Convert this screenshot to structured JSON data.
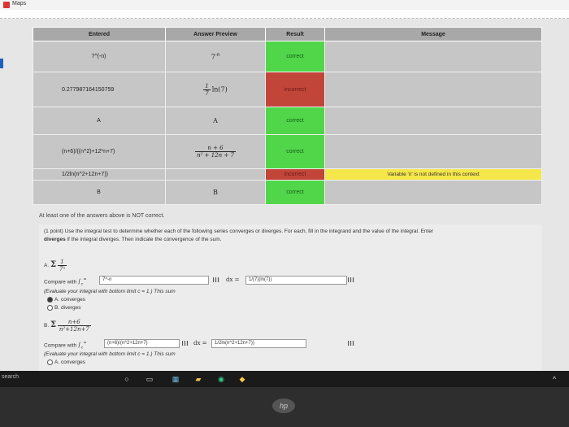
{
  "window": {
    "title": "Maps"
  },
  "table": {
    "headers": [
      "Entered",
      "Answer Preview",
      "Result",
      "Message"
    ],
    "rows": [
      {
        "entered": "7^(-n)",
        "preview_base": "7",
        "preview_exp": "-n",
        "result": "correct",
        "message": ""
      },
      {
        "entered": "0.277987164150759",
        "preview_num": "1",
        "preview_den": "7",
        "preview_rest": "ln(7)",
        "result": "incorrect",
        "message": ""
      },
      {
        "entered": "A",
        "preview": "A",
        "result": "correct",
        "message": ""
      },
      {
        "entered": "(n+6)/((n^2)+12*n+7)",
        "preview_num": "n + 6",
        "preview_den": "n² + 12n + 7",
        "result": "correct",
        "message": ""
      },
      {
        "entered": "1/2ln(n^2+12n+7))",
        "preview": "",
        "result": "incorrect",
        "message": "Variable 'n' is not defined in this context"
      },
      {
        "entered": "B",
        "preview": "B",
        "result": "correct",
        "message": ""
      }
    ]
  },
  "notice": "At least one of the answers above is NOT correct.",
  "problem": {
    "intro": "(1 point) Use the integral test to determine whether each of the following series converges or diverges. For each, fill in the integrand and the value of the integral. Enter",
    "intro2_bold": "diverges",
    "intro2": " if the integral diverges. Then indicate the convergence of the sum.",
    "partA": {
      "label": "A.",
      "term_num": "1",
      "term_den": "7ⁿ",
      "compare_label": "Compare with",
      "integrand": "7^-n",
      "dx_label": "dx =",
      "integral_value": "1/(7)(ln(7))",
      "hint": "(Evaluate your integral with bottom limit c = 1.) This sum",
      "options": [
        "A. converges",
        "B. diverges"
      ],
      "selected": 0
    },
    "partB": {
      "label": "B.",
      "term_num": "n+6",
      "term_den": "n²+12n+7",
      "compare_label": "Compare with",
      "integrand": "(n+6)/(n^2+12n+7)",
      "dx_label": "dx =",
      "integral_value": "1/2ln(n^2+12n+7))",
      "hint": "(Evaluate your integral with bottom limit c = 1.) This sum",
      "options": [
        "A. converges"
      ]
    }
  },
  "taskbar": {
    "search_label": "search"
  },
  "bezel": {
    "logo": "hp"
  }
}
